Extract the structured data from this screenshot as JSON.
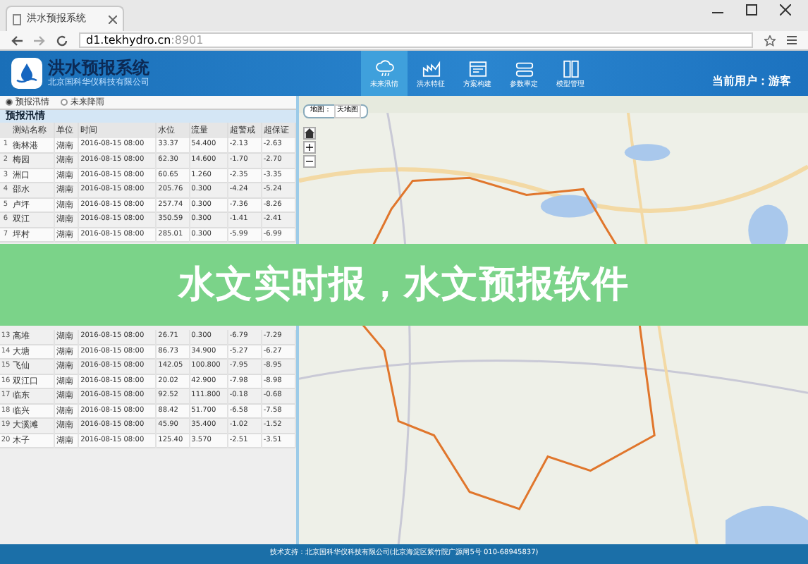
{
  "browser": {
    "tab_title": "洪水预报系统",
    "url_host": "d1.tekhydro.cn",
    "url_port": ":8901"
  },
  "app": {
    "title": "洪水预报系统",
    "subtitle": "北京国科华仪科技有限公司",
    "current_user": "当前用户：游客"
  },
  "nav": [
    {
      "label": "未来汛情",
      "selected": true
    },
    {
      "label": "洪水特征",
      "selected": false
    },
    {
      "label": "方案构建",
      "selected": false
    },
    {
      "label": "参数率定",
      "selected": false
    },
    {
      "label": "模型管理",
      "selected": false
    }
  ],
  "modes": [
    {
      "label": "预报汛情",
      "selected": true
    },
    {
      "label": "未来降雨",
      "selected": false
    }
  ],
  "panel_title": "预报汛情",
  "table": {
    "columns": [
      "测站名称",
      "单位",
      "时间",
      "水位",
      "流量",
      "超警戒",
      "超保证"
    ],
    "rows": [
      {
        "no": "1",
        "cells": [
          "衡林港",
          "湖南",
          "2016-08-15 08:00",
          "33.37",
          "54.400",
          "-2.13",
          "-2.63"
        ]
      },
      {
        "no": "2",
        "cells": [
          "梅园",
          "湖南",
          "2016-08-15 08:00",
          "62.30",
          "14.600",
          "-1.70",
          "-2.70"
        ]
      },
      {
        "no": "3",
        "cells": [
          "洲口",
          "湖南",
          "2016-08-15 08:00",
          "60.65",
          "1.260",
          "-2.35",
          "-3.35"
        ]
      },
      {
        "no": "4",
        "cells": [
          "邵水",
          "湖南",
          "2016-08-15 08:00",
          "205.76",
          "0.300",
          "-4.24",
          "-5.24"
        ]
      },
      {
        "no": "5",
        "cells": [
          "卢坪",
          "湖南",
          "2016-08-15 08:00",
          "257.74",
          "0.300",
          "-7.36",
          "-8.26"
        ]
      },
      {
        "no": "6",
        "cells": [
          "双江",
          "湖南",
          "2016-08-15 08:00",
          "350.59",
          "0.300",
          "-1.41",
          "-2.41"
        ]
      },
      {
        "no": "7",
        "cells": [
          "坪村",
          "湖南",
          "2016-08-15 08:00",
          "285.01",
          "0.300",
          "-5.99",
          "-6.99"
        ]
      },
      {
        "no": "13",
        "gap_before": true,
        "cells": [
          "高堆",
          "湖南",
          "2016-08-15 08:00",
          "26.71",
          "0.300",
          "-6.79",
          "-7.29"
        ]
      },
      {
        "no": "14",
        "cells": [
          "大塘",
          "湖南",
          "2016-08-15 08:00",
          "86.73",
          "34.900",
          "-5.27",
          "-6.27"
        ]
      },
      {
        "no": "15",
        "cells": [
          "飞仙",
          "湖南",
          "2016-08-15 08:00",
          "142.05",
          "100.800",
          "-7.95",
          "-8.95"
        ]
      },
      {
        "no": "16",
        "cells": [
          "双江口",
          "湖南",
          "2016-08-15 08:00",
          "20.02",
          "42.900",
          "-7.98",
          "-8.98"
        ]
      },
      {
        "no": "17",
        "cells": [
          "临东",
          "湖南",
          "2016-08-15 08:00",
          "92.52",
          "111.800",
          "-0.18",
          "-0.68"
        ]
      },
      {
        "no": "18",
        "cells": [
          "临兴",
          "湖南",
          "2016-08-15 08:00",
          "88.42",
          "51.700",
          "-6.58",
          "-7.58"
        ]
      },
      {
        "no": "19",
        "cells": [
          "大溪滩",
          "湖南",
          "2016-08-15 08:00",
          "45.90",
          "35.400",
          "-1.02",
          "-1.52"
        ]
      },
      {
        "no": "20",
        "cells": [
          "木子",
          "湖南",
          "2016-08-15 08:00",
          "125.40",
          "3.570",
          "-2.51",
          "-3.51"
        ]
      }
    ]
  },
  "map": {
    "kind": "picture",
    "layer_label": "地图：",
    "layer_value": "天地图",
    "zoom_in": "+",
    "zoom_out": "−"
  },
  "footer": "技术支持：北京国科华仪科技有限公司(北京海淀区紫竹院广源闸5号 010-68945837)",
  "banner": "水文实时报，水文预报软件"
}
